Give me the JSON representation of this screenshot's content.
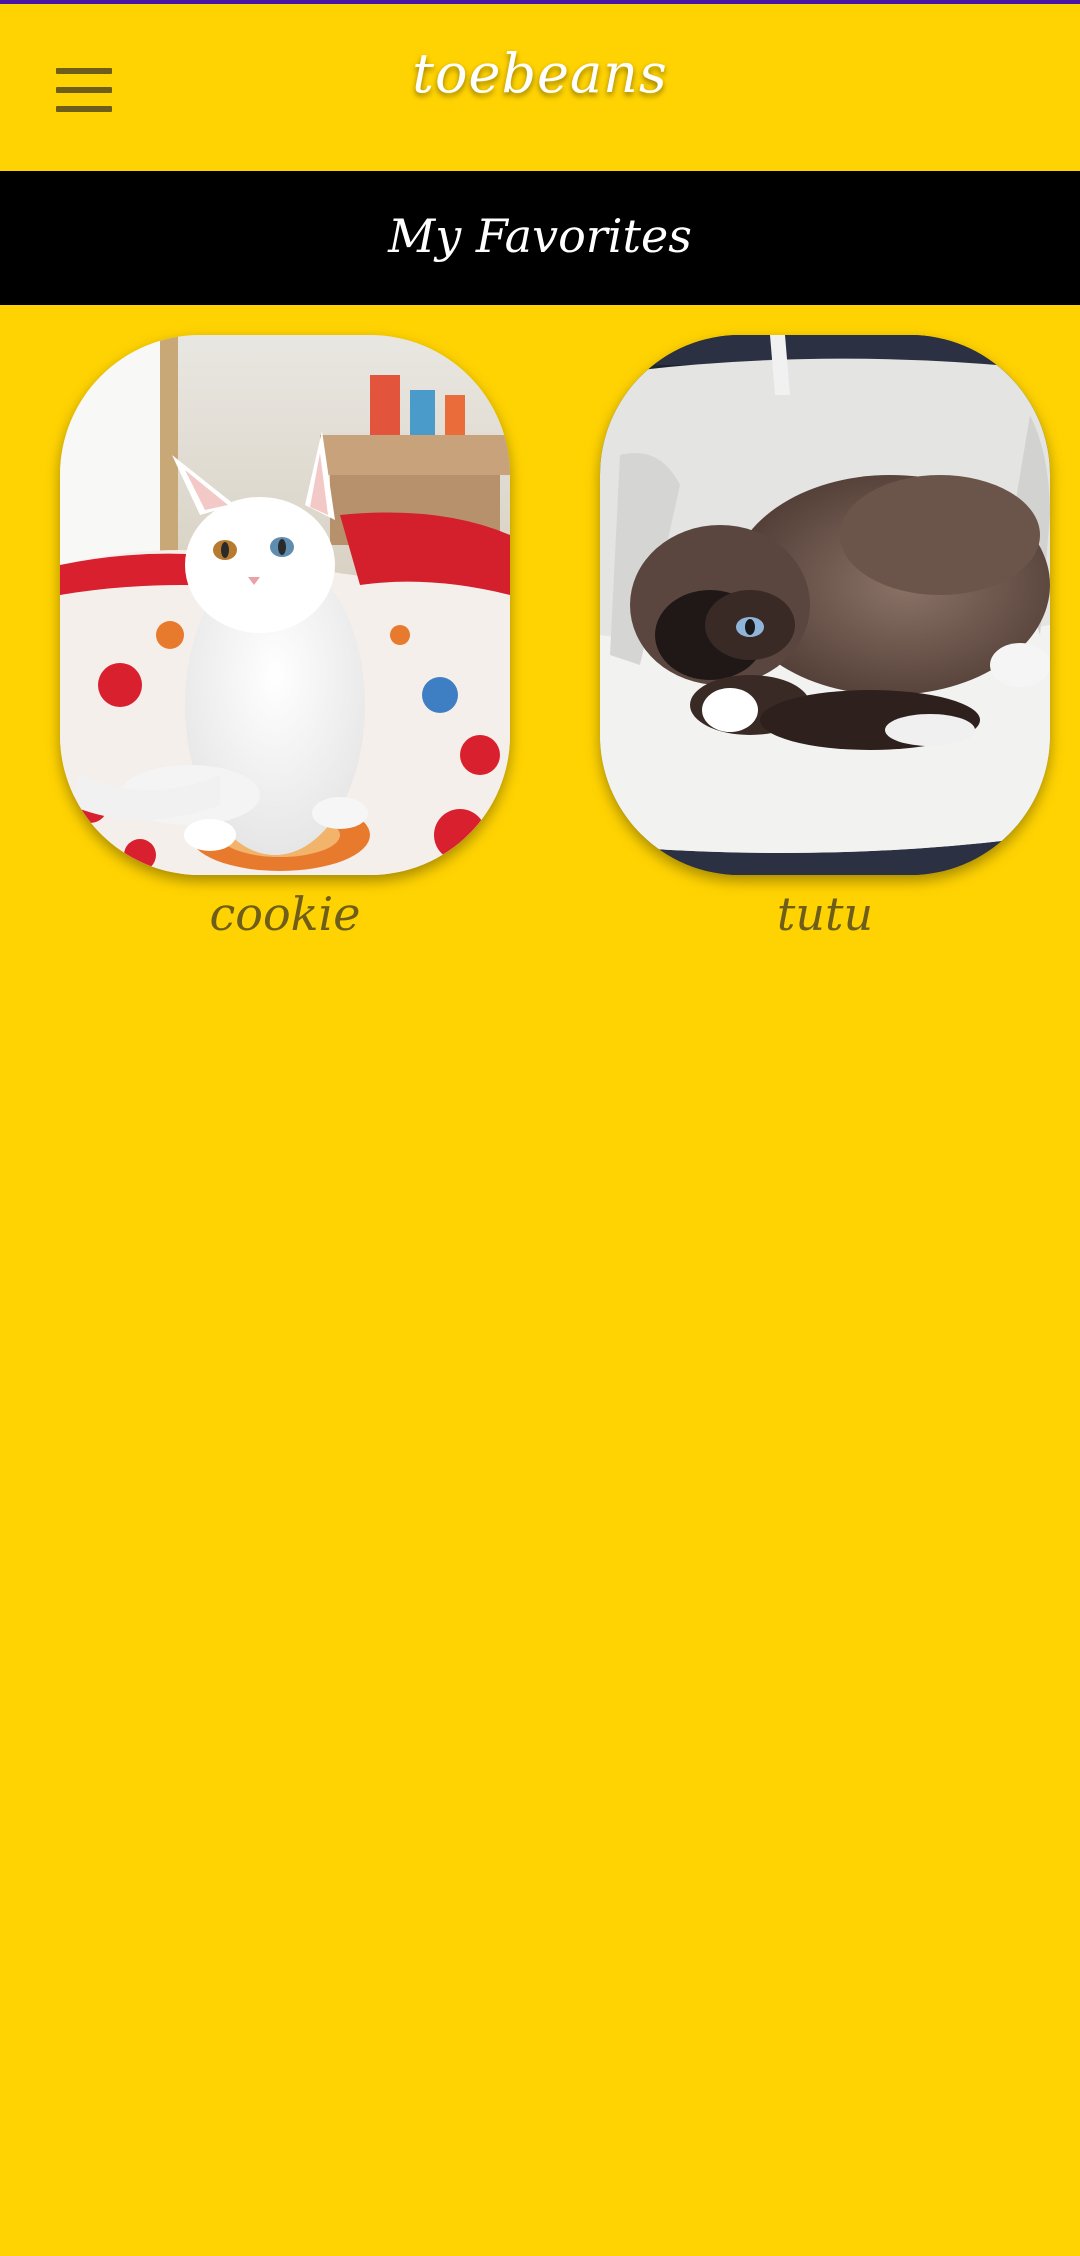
{
  "app_bar": {
    "title": "toebeans",
    "menu_icon": "hamburger-menu-icon"
  },
  "section": {
    "title": "My Favorites"
  },
  "favorites": [
    {
      "name": "cookie",
      "photo": "white cat sitting on a blanket"
    },
    {
      "name": "tutu",
      "photo": "siamese cat curled up in a paper bag"
    }
  ],
  "colors": {
    "background": "#FFD302",
    "header_band": "#000000",
    "label_text": "#6E5E1A",
    "status_strip": "#4B14A6"
  }
}
